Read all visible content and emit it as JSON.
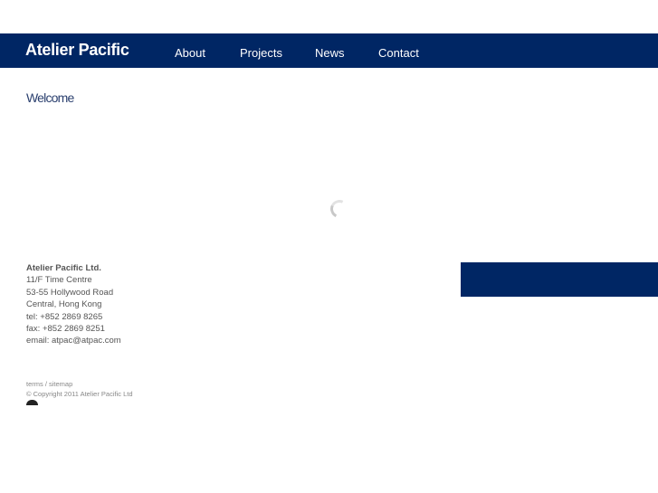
{
  "header": {
    "logo": "Atelier Pacific",
    "nav": [
      {
        "label": "About"
      },
      {
        "label": "Projects"
      },
      {
        "label": "News"
      },
      {
        "label": "Contact"
      }
    ]
  },
  "main": {
    "title": "Welcome"
  },
  "address": {
    "company": "Atelier Pacific Ltd.",
    "lines": [
      "11/F Time Centre",
      "53-55 Hollywood Road",
      "Central, Hong Kong",
      "tel: +852 2869 8265",
      "fax: +852 2869 8251",
      "email: atpac@atpac.com"
    ]
  },
  "footer": {
    "terms": "terms",
    "separator": " / ",
    "sitemap": "sitemap",
    "copyright": "© Copyright 2011 Atelier Pacific Ltd"
  },
  "colors": {
    "brand": "#002664"
  }
}
